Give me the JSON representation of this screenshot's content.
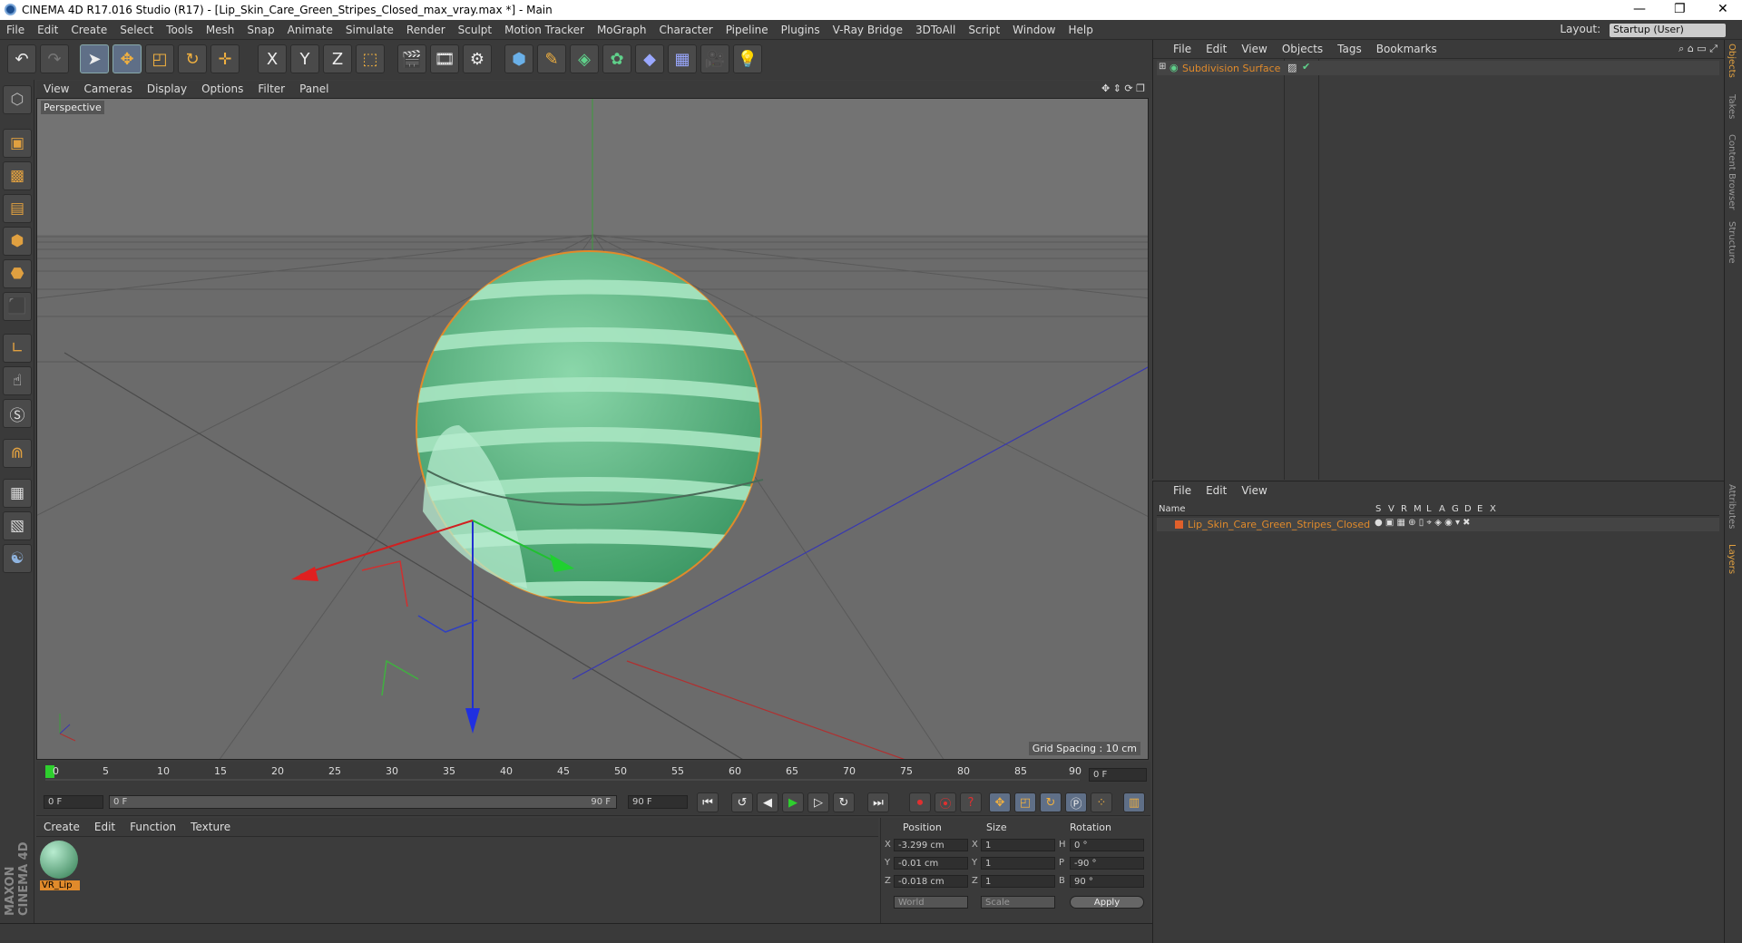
{
  "window": {
    "title": "CINEMA 4D R17.016 Studio (R17) - [Lip_Skin_Care_Green_Stripes_Closed_max_vray.max *] - Main",
    "min": "—",
    "max": "❐",
    "close": "✕"
  },
  "menubar": {
    "items": [
      "File",
      "Edit",
      "Create",
      "Select",
      "Tools",
      "Mesh",
      "Snap",
      "Animate",
      "Simulate",
      "Render",
      "Sculpt",
      "Motion Tracker",
      "MoGraph",
      "Character",
      "Pipeline",
      "Plugins",
      "V-Ray Bridge",
      "3DToAll",
      "Script",
      "Window",
      "Help"
    ],
    "layout_label": "Layout:",
    "layout_value": "Startup (User)"
  },
  "toolbar": {
    "icons": [
      "undo-icon",
      "redo-icon",
      "select-arrow-icon",
      "move-icon",
      "scale-icon",
      "rotate-icon",
      "live-select-icon",
      "x-axis-icon",
      "y-axis-icon",
      "z-axis-icon",
      "coordinate-system-icon",
      "render-view-icon",
      "render-picture-icon",
      "edit-render-settings-icon",
      "cube-icon",
      "pen-icon",
      "subdivision-icon",
      "cloner-icon",
      "deformer-icon",
      "floor-icon",
      "camera-icon",
      "light-icon"
    ],
    "axis_x": "X",
    "axis_y": "Y",
    "axis_z": "Z"
  },
  "left_toolbar": {
    "icons": [
      "make-editable-icon",
      "model-mode-icon",
      "texture-mode-icon",
      "workplane-icon",
      "points-mode-icon",
      "edges-mode-icon",
      "polygons-mode-icon",
      "axis-mode-icon",
      "tweak-icon",
      "snap-icon",
      "magnet-icon",
      "grid-lock-icon",
      "workplane-lock-icon",
      "python-icon"
    ]
  },
  "branding": {
    "text": "MAXON CINEMA 4D"
  },
  "viewport": {
    "menu": [
      "View",
      "Cameras",
      "Display",
      "Options",
      "Filter",
      "Panel"
    ],
    "label": "Perspective",
    "grid_spacing": "Grid Spacing : 10 cm",
    "colors": {
      "background": "#6b6b6b",
      "object": "#6dc494",
      "stripes": "#a9e6c2",
      "selection": "#e08a2b"
    }
  },
  "timeline": {
    "ticks": [
      "0",
      "5",
      "10",
      "15",
      "20",
      "25",
      "30",
      "35",
      "40",
      "45",
      "50",
      "55",
      "60",
      "65",
      "70",
      "75",
      "80",
      "85",
      "90"
    ],
    "frame_field": "0 F"
  },
  "playback": {
    "start_field": "0 F",
    "range_start": "0 F",
    "range_end": "90 F",
    "end_field": "90 F"
  },
  "material_manager": {
    "menu": [
      "Create",
      "Edit",
      "Function",
      "Texture"
    ],
    "material_name": "VR_Lip"
  },
  "coordinates": {
    "headers": [
      "Position",
      "Size",
      "Rotation"
    ],
    "rows": [
      {
        "axis": "X",
        "pos": "-3.299 cm",
        "size_axis": "X",
        "size": "1",
        "rot_axis": "H",
        "rot": "0 °"
      },
      {
        "axis": "Y",
        "pos": "-0.01 cm",
        "size_axis": "Y",
        "size": "1",
        "rot_axis": "P",
        "rot": "-90 °"
      },
      {
        "axis": "Z",
        "pos": "-0.018 cm",
        "size_axis": "Z",
        "size": "1",
        "rot_axis": "B",
        "rot": "90 °"
      }
    ],
    "mode": "World",
    "size_mode": "Scale",
    "apply": "Apply"
  },
  "object_manager": {
    "menu": [
      "File",
      "Edit",
      "View",
      "Objects",
      "Tags",
      "Bookmarks"
    ],
    "objects": [
      {
        "name": "Subdivision Surface",
        "color": "#e08a2b"
      }
    ]
  },
  "layer_manager": {
    "menu": [
      "File",
      "Edit",
      "View"
    ],
    "columns": [
      "Name",
      "S",
      "V",
      "R",
      "M",
      "L",
      "A",
      "G",
      "D",
      "E",
      "X"
    ],
    "layers": [
      {
        "name": "Lip_Skin_Care_Green_Stripes_Closed",
        "color": "#e0602b"
      }
    ]
  },
  "side_tabs": [
    "Objects",
    "Takes",
    "Content Browser",
    "Structure",
    "Attributes",
    "Layers"
  ]
}
